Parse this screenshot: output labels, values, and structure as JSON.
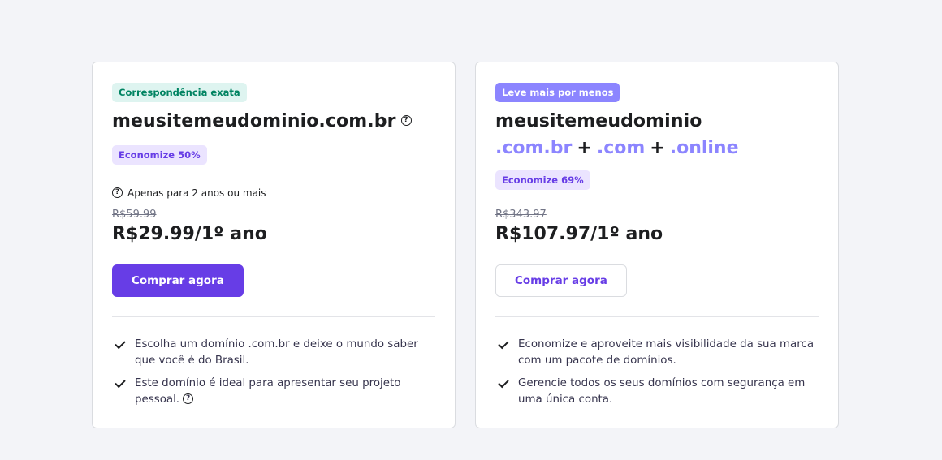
{
  "cards": [
    {
      "badge": "Correspondência exata",
      "domain": "meusitemeudominio.com.br",
      "discount": "Economize 50%",
      "note": "Apenas para 2 anos ou mais",
      "old_price": "R$59.99",
      "price": "R$29.99/1º ano",
      "button": "Comprar agora",
      "features": [
        "Escolha um domínio .com.br e deixe o mundo saber que você é do Brasil.",
        "Este domínio é ideal para apresentar seu projeto pessoal."
      ]
    },
    {
      "badge": "Leve mais por menos",
      "domain": "meusitemeudominio",
      "tlds": [
        ".com.br",
        ".com",
        ".online"
      ],
      "plus": "+",
      "discount": "Economize 69%",
      "old_price": "R$343.97",
      "price": "R$107.97/1º ano",
      "button": "Comprar agora",
      "features": [
        "Economize e aproveite mais visibilidade da sua marca com um pacote de domínios.",
        "Gerencie todos os seus domínios com segurança em uma única conta."
      ]
    }
  ],
  "help_icon_glyph": "?",
  "colors": {
    "accent": "#673de6",
    "tld": "#8c85ff",
    "match_badge_bg": "#def4f0",
    "match_badge_text": "#008361",
    "discount_bg": "#ebe4ff"
  }
}
